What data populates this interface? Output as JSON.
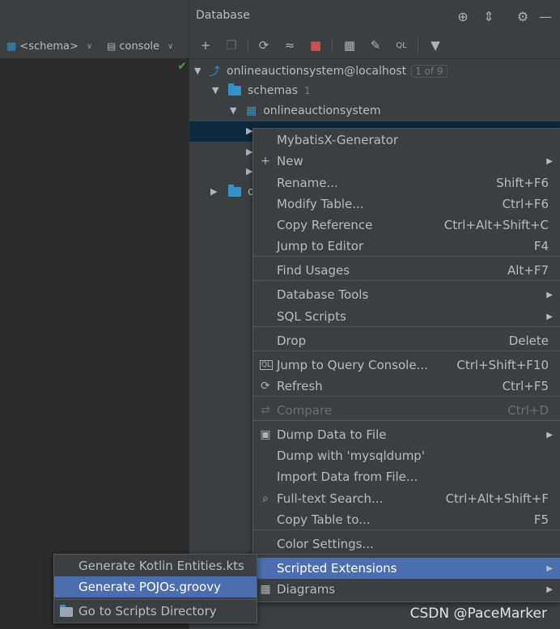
{
  "left_toolbar": {
    "schema_label": "<schema>",
    "console_label": "console"
  },
  "db_panel": {
    "title": "Database",
    "tree": {
      "connection": "onlineauctionsystem@localhost",
      "connection_badge": "1 of 9",
      "schemas_label": "schemas",
      "schemas_count": "1",
      "schema_name": "onlineauctionsystem",
      "partial_row_label": "o"
    }
  },
  "context_menu": {
    "items": [
      {
        "label": "MybatisX-Generator",
        "shortcut": "",
        "submenu": false,
        "icon": ""
      },
      {
        "label": "New",
        "shortcut": "",
        "submenu": true,
        "icon": "plus-icon"
      },
      {
        "label": "Rename...",
        "shortcut": "Shift+F6",
        "submenu": false,
        "icon": ""
      },
      {
        "label": "Modify Table...",
        "shortcut": "Ctrl+F6",
        "submenu": false,
        "icon": ""
      },
      {
        "label": "Copy Reference",
        "shortcut": "Ctrl+Alt+Shift+C",
        "submenu": false,
        "icon": ""
      },
      {
        "label": "Jump to Editor",
        "shortcut": "F4",
        "submenu": false,
        "icon": ""
      },
      {
        "label": "Find Usages",
        "shortcut": "Alt+F7",
        "submenu": false,
        "icon": ""
      },
      {
        "label": "Database Tools",
        "shortcut": "",
        "submenu": true,
        "icon": ""
      },
      {
        "label": "SQL Scripts",
        "shortcut": "",
        "submenu": true,
        "icon": ""
      },
      {
        "label": "Drop",
        "shortcut": "Delete",
        "submenu": false,
        "icon": ""
      },
      {
        "label": "Jump to Query Console...",
        "shortcut": "Ctrl+Shift+F10",
        "submenu": false,
        "icon": "ql-icon"
      },
      {
        "label": "Refresh",
        "shortcut": "Ctrl+F5",
        "submenu": false,
        "icon": "refresh-icon"
      },
      {
        "label": "Compare",
        "shortcut": "Ctrl+D",
        "submenu": false,
        "icon": "compare-icon"
      },
      {
        "label": "Dump Data to File",
        "shortcut": "",
        "submenu": true,
        "icon": "save-icon"
      },
      {
        "label": "Dump with 'mysqldump'",
        "shortcut": "",
        "submenu": false,
        "icon": ""
      },
      {
        "label": "Import Data from File...",
        "shortcut": "",
        "submenu": false,
        "icon": ""
      },
      {
        "label": "Full-text Search...",
        "shortcut": "Ctrl+Alt+Shift+F",
        "submenu": false,
        "icon": "search-icon"
      },
      {
        "label": "Copy Table to...",
        "shortcut": "F5",
        "submenu": false,
        "icon": ""
      },
      {
        "label": "Color Settings...",
        "shortcut": "",
        "submenu": false,
        "icon": ""
      },
      {
        "label": "Scripted Extensions",
        "shortcut": "",
        "submenu": true,
        "icon": ""
      },
      {
        "label": "Diagrams",
        "shortcut": "",
        "submenu": true,
        "icon": "diagram-icon"
      }
    ]
  },
  "submenu": {
    "items": [
      {
        "label": "Generate Kotlin Entities.kts"
      },
      {
        "label": "Generate POJOs.groovy"
      },
      {
        "label": "Go to Scripts Directory"
      }
    ]
  },
  "watermark": "CSDN @PaceMarker",
  "colors": {
    "background": "#2b2b2b",
    "panel": "#3c3f41",
    "selection": "#4b6eaf",
    "tree_selection": "#0d293e",
    "folder": "#3592c4",
    "stop_red": "#c75450",
    "check_green": "#499c54"
  }
}
